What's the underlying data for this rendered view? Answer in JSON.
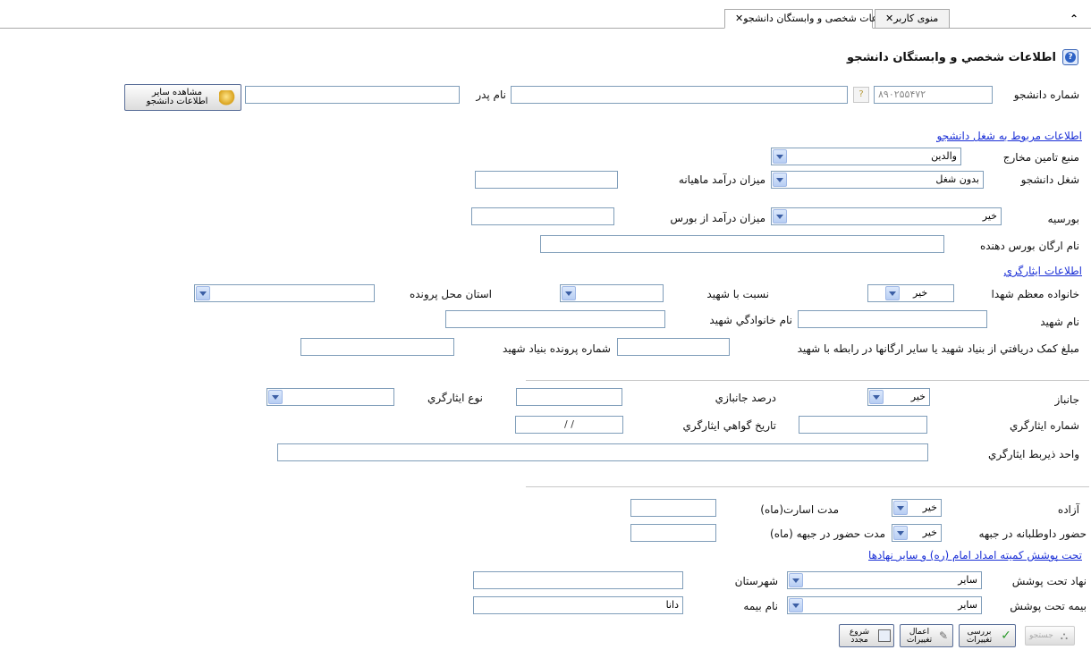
{
  "tabs": [
    {
      "label": "اطلاعات شخصی و وابستگان دانشجو",
      "active": true
    },
    {
      "label": "منوی کاربر",
      "active": false
    }
  ],
  "page": {
    "title": "اطلاعات شخصي و وابستگان دانشجو",
    "student_no_label": "شماره دانشجو",
    "student_no_value": "۸۹۰۲۵۵۴۷۲",
    "father_name_label": "نام پدر",
    "view_other_btn": "مشاهده ساير اطلاعات دانشجو"
  },
  "job": {
    "link": "اطلاعات مربوط به شغل دانشجو",
    "funding_label": "منبع تامين مخارج",
    "funding_value": "والدين",
    "job_label": "شغل دانشجو",
    "job_value": "بدون شغل",
    "income_label": "ميزان درآمد ماهيانه",
    "scholarship_label": "بورسيه",
    "scholarship_value": "خير",
    "scholar_income_label": "ميزان درآمد از بورس",
    "scholar_org_label": "نام ارگان بورس دهنده"
  },
  "sacrifice": {
    "link": "اطلاعات ايثارگري",
    "martyr_family_label": "خانواده معظم شهدا",
    "martyr_family_value": "خير",
    "relation_label": "نسبت با شهيد",
    "province_label": "استان محل پرونده",
    "martyr_name_label": "نام شهيد",
    "martyr_lastname_label": "نام خانوادگي شهيد",
    "aid_label": "مبلغ کمک دريافتي از بنياد شهيد يا ساير ارگانها در رابطه با شهيد",
    "file_no_label": "شماره پرونده بنياد شهيد"
  },
  "veteran": {
    "janbaz_label": "جانباز",
    "janbaz_value": "خير",
    "percent_label": "درصد جانبازي",
    "type_label": "نوع ايثارگري",
    "number_label": "شماره ايثارگري",
    "cert_date_label": "تاريخ گواهي ايثارگري",
    "cert_date_value": "/    /",
    "unit_label": "واحد ذيربط ايثارگري"
  },
  "captive": {
    "freed_label": "آزاده",
    "freed_value": "خير",
    "captivity_label": "مدت اسارت(ماه)",
    "volunteer_label": "حضور داوطلبانه در جبهه",
    "volunteer_value": "خير",
    "front_label": "مدت حضور در جبهه (ماه)"
  },
  "coverage": {
    "link": "تحت پوشش کميته امداد امام (ره) و ساير نهادها",
    "org_label": "نهاد تحت پوشش",
    "org_value": "ساير",
    "city_label": "شهرستان",
    "insurance_label": "بيمه تحت پوشش",
    "insurance_value": "ساير",
    "insurance_name_label": "نام بيمه",
    "insurance_name_value": "دانا"
  },
  "toolbar": {
    "search": "جستجو",
    "review": "بررسی تغییرات",
    "apply": "اعمال تغییرات",
    "restart": "شروع مجدد"
  }
}
